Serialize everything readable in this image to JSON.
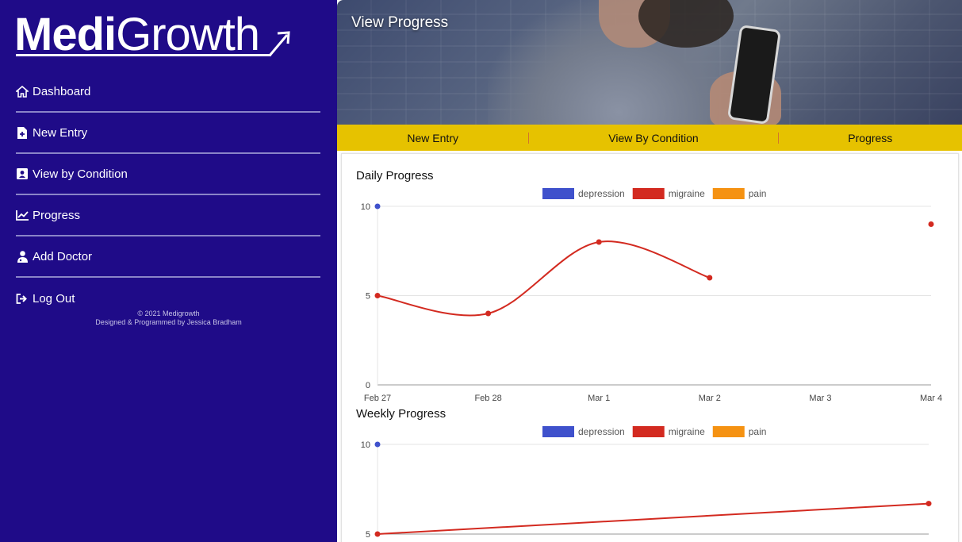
{
  "logo": {
    "bold": "Medi",
    "light": "Growth"
  },
  "sidebar": {
    "items": [
      {
        "label": "Dashboard",
        "icon": "home-icon"
      },
      {
        "label": "New Entry",
        "icon": "file-plus-icon"
      },
      {
        "label": "View by Condition",
        "icon": "id-card-icon"
      },
      {
        "label": "Progress",
        "icon": "chart-line-icon"
      },
      {
        "label": "Add Doctor",
        "icon": "doctor-icon"
      },
      {
        "label": "Log Out",
        "icon": "sign-out-icon"
      }
    ],
    "footer_line1": "© 2021 Medigrowth",
    "footer_line2": "Designed & Programmed by Jessica Bradham"
  },
  "header": {
    "title": "View Progress"
  },
  "tabs": [
    "New Entry",
    "View By Condition",
    "Progress"
  ],
  "colors": {
    "sidebar": "#1f0b88",
    "tabbar": "#e6c200",
    "depression": "#3f51cc",
    "migraine": "#d32a20",
    "pain": "#f59212"
  },
  "chart_data": [
    {
      "type": "line",
      "title": "Daily Progress",
      "categories": [
        "Feb 27",
        "Feb 28",
        "Mar 1",
        "Mar 2",
        "Mar 3",
        "Mar 4"
      ],
      "ylim": [
        0,
        10
      ],
      "yticks": [
        0,
        5,
        10
      ],
      "legend": "top",
      "grid": true,
      "series": [
        {
          "name": "depression",
          "color": "#3f51cc",
          "values": [
            10,
            null,
            null,
            null,
            null,
            null
          ]
        },
        {
          "name": "migraine",
          "color": "#d32a20",
          "values": [
            5,
            4,
            8,
            6,
            null,
            9
          ]
        },
        {
          "name": "pain",
          "color": "#f59212",
          "values": [
            null,
            null,
            null,
            null,
            null,
            null
          ]
        }
      ]
    },
    {
      "type": "line",
      "title": "Weekly Progress",
      "ylim": [
        5,
        10
      ],
      "yticks": [
        5,
        10
      ],
      "legend": "top",
      "grid": true,
      "series": [
        {
          "name": "depression",
          "color": "#3f51cc",
          "values": [
            10,
            null
          ]
        },
        {
          "name": "migraine",
          "color": "#d32a20",
          "values": [
            5,
            6.7
          ]
        },
        {
          "name": "pain",
          "color": "#f59212",
          "values": [
            null,
            null
          ]
        }
      ]
    }
  ]
}
